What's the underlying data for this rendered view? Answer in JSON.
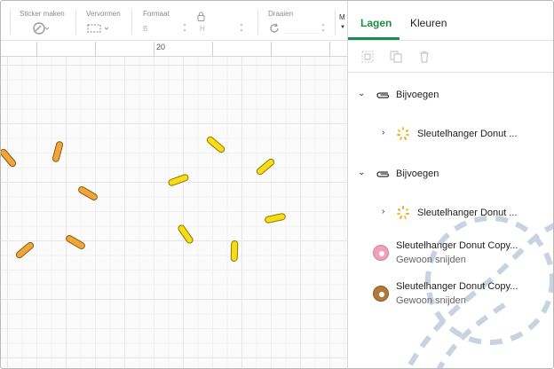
{
  "toolbar": {
    "sticker_label": "Sticker maken",
    "warp_label": "Vervormen",
    "size_label": "Formaat",
    "size_w_letter": "B",
    "size_h_letter": "H",
    "rotate_label": "Draaien",
    "more_label": "M"
  },
  "ruler": {
    "label": "20"
  },
  "panel": {
    "tabs": [
      {
        "label": "Lagen",
        "active": true
      },
      {
        "label": "Kleuren",
        "active": false
      }
    ],
    "actions": [
      {
        "name": "group-icon"
      },
      {
        "name": "duplicate-icon"
      },
      {
        "name": "delete-icon"
      }
    ],
    "layers": [
      {
        "type": "group",
        "label": "Bijvoegen",
        "expanded": true
      },
      {
        "type": "item",
        "label": "Sleutelhanger Donut ...",
        "icon": "sprinkles-icon",
        "collapsed": true
      },
      {
        "type": "group",
        "label": "Bijvoegen",
        "expanded": true
      },
      {
        "type": "item",
        "label": "Sleutelhanger Donut ...",
        "icon": "sprinkles-icon",
        "collapsed": true
      },
      {
        "type": "leaf",
        "label": "Sleutelhanger Donut Copy...",
        "sub": "Gewoon snijden",
        "icon": "pink-donut-icon",
        "color": "#f0a0b8"
      },
      {
        "type": "leaf",
        "label": "Sleutelhanger Donut Copy...",
        "sub": "Gewoon snijden",
        "icon": "brown-donut-icon",
        "color": "#b07a3c"
      }
    ]
  },
  "colors": {
    "accent": "#1e8a4c",
    "sprinkle_orange": "#f0a63a",
    "sprinkle_yellow": "#f7dc16"
  }
}
